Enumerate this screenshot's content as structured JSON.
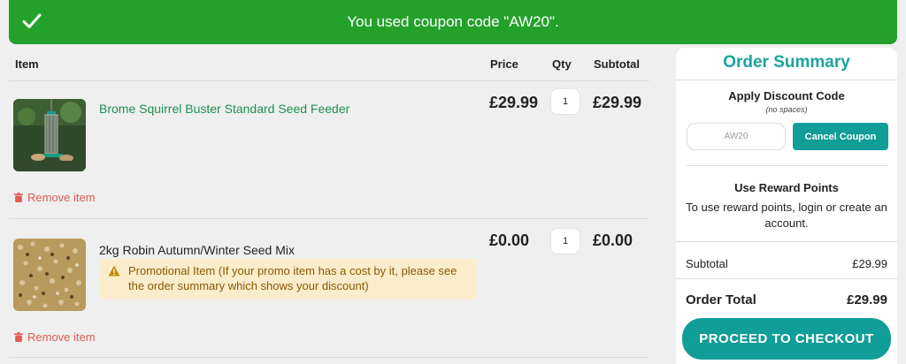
{
  "banner": {
    "message": "You used coupon code \"AW20\".",
    "icon": "check-icon"
  },
  "cart": {
    "headers": {
      "item": "Item",
      "price": "Price",
      "qty": "Qty",
      "subtotal": "Subtotal"
    },
    "items": [
      {
        "name": "Brome Squirrel Buster Standard Seed Feeder",
        "price": "£29.99",
        "qty": "1",
        "subtotal": "£29.99",
        "remove_label": "Remove item"
      },
      {
        "name": "2kg Robin Autumn/Winter Seed Mix",
        "price": "£0.00",
        "qty": "1",
        "subtotal": "£0.00",
        "remove_label": "Remove item",
        "promo_note": "Promotional Item (If your promo item has a cost by it, please see the order summary which shows your discount)"
      }
    ]
  },
  "summary": {
    "title": "Order Summary",
    "discount": {
      "title": "Apply Discount Code",
      "subtitle": "(no spaces)",
      "code_value": "AW20",
      "cancel_label": "Cancel Coupon"
    },
    "rewards": {
      "title": "Use Reward Points",
      "text": "To use reward points, login or create an account."
    },
    "subtotal_label": "Subtotal",
    "subtotal_value": "£29.99",
    "total_label": "Order Total",
    "total_value": "£29.99",
    "checkout_label": "PROCEED TO CHECKOUT"
  },
  "colors": {
    "success_green": "#23a12a",
    "accent_teal": "#119d98",
    "link_green": "#1e8f52",
    "remove_red": "#e05a4f",
    "promo_bg": "#fbeccc"
  }
}
